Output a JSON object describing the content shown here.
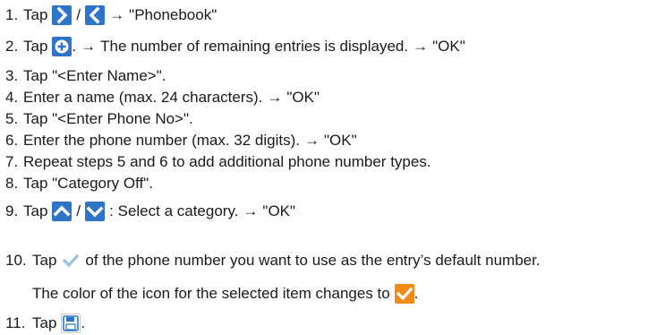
{
  "steps": [
    {
      "num": "1.",
      "pre": "Tap",
      "sep": "/",
      "arrow": "→",
      "post": "\"Phonebook\""
    },
    {
      "num": "2.",
      "pre": "Tap",
      "mid": ".",
      "arrow1": "→",
      "text": "The number of remaining entries is displayed.",
      "arrow2": "→",
      "post": "\"OK\""
    },
    {
      "num": "3.",
      "text": "Tap \"<Enter Name>\"."
    },
    {
      "num": "4.",
      "text": "Enter a name (max. 24 characters).",
      "arrow": "→",
      "post": "\"OK\""
    },
    {
      "num": "5.",
      "text": "Tap \"<Enter Phone No>\"."
    },
    {
      "num": "6.",
      "text": "Enter the phone number (max. 32 digits).",
      "arrow": "→",
      "post": "\"OK\""
    },
    {
      "num": "7.",
      "text": "Repeat steps 5 and 6 to add additional phone number types."
    },
    {
      "num": "8.",
      "text": "Tap \"Category Off\"."
    },
    {
      "num": "9.",
      "pre": "Tap",
      "sep": "/",
      "text": ": Select a category.",
      "arrow": "→",
      "post": "\"OK\""
    },
    {
      "num": "10.",
      "pre": "Tap",
      "text": "of the phone number you want to use as the entry’s default number."
    },
    {
      "num": "11.",
      "pre": "Tap",
      "post": "."
    }
  ],
  "note": {
    "text": "The color of the icon for the selected item changes to",
    "end": "."
  },
  "icons": {
    "next": "chevron-right-icon",
    "back": "chevron-left-icon",
    "add": "add-circle-icon",
    "up": "chevron-up-icon",
    "down": "chevron-down-icon",
    "check_default": "check-icon",
    "check_selected": "check-icon",
    "save": "save-icon"
  },
  "colors": {
    "icon_blue": "#2e74c8",
    "check_default": "#9fc2e8",
    "check_selected": "#f28b16",
    "text": "#1a1a1a"
  }
}
